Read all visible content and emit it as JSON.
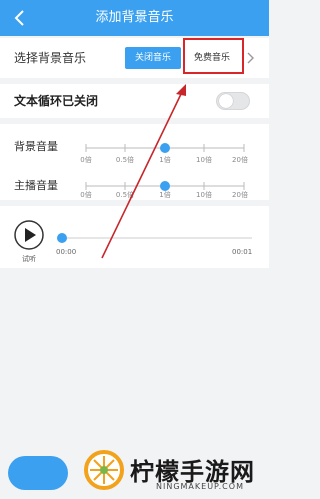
{
  "header": {
    "title": "添加背景音乐"
  },
  "music_row": {
    "label": "选择背景音乐",
    "btn_off": "关闭音乐",
    "btn_free": "免费音乐"
  },
  "loop_row": {
    "label": "文本循环已关闭",
    "toggle_on": false
  },
  "volume": {
    "bg_label": "背景音量",
    "host_label": "主播音量",
    "ticks": [
      "0倍",
      "0.5倍",
      "1倍",
      "10倍",
      "20倍"
    ],
    "bg_level": "1倍",
    "host_level": "1倍"
  },
  "preview": {
    "label": "试听",
    "time_start": "00:00",
    "time_end": "00:01",
    "progress": 0
  },
  "watermark": {
    "text": "柠檬手游网",
    "url": "NINGMAKEUP.COM"
  },
  "colors": {
    "accent": "#3aa0ef",
    "highlight": "#d9262a"
  }
}
